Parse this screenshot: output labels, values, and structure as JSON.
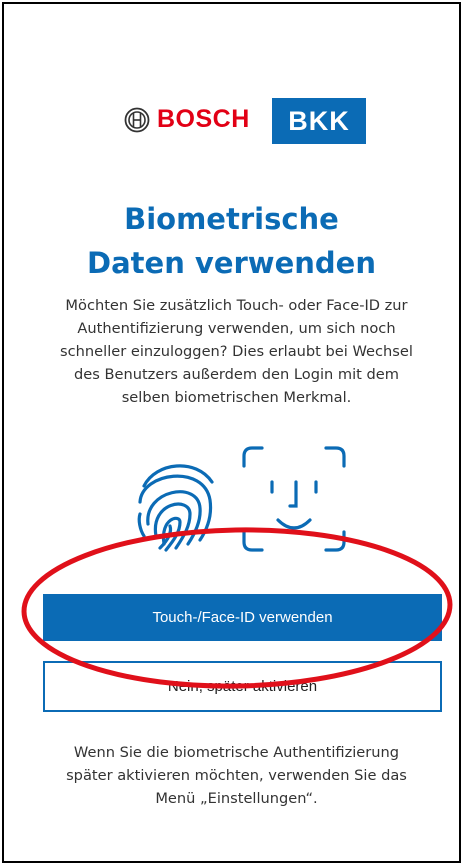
{
  "brand": {
    "bosch_text": "BOSCH",
    "bkk_text": "BKK",
    "bosch_color": "#e20015",
    "bkk_color": "#0b6bb5"
  },
  "title": {
    "line1": "Biometrische",
    "line2": "Daten verwenden"
  },
  "description": {
    "lines": [
      "Möchten Sie zusätzlich Touch- oder Face-ID zur",
      "Authentifizierung verwenden, um sich noch",
      "schneller einzuloggen? Dies erlaubt bei Wechsel",
      "des Benutzers außerdem den Login mit dem",
      "selben biometrischen Merkmal."
    ]
  },
  "icons": [
    "fingerprint-icon",
    "face-id-icon"
  ],
  "buttons": {
    "primary_label": "Touch-/Face-ID verwenden",
    "secondary_label": "Nein, später aktivieren"
  },
  "note": {
    "lines": [
      "Wenn Sie die biometrische Authentifizierung",
      "später aktivieren möchten, verwenden Sie das",
      "Menü „Einstellungen“."
    ]
  },
  "colors": {
    "accent": "#0b6bb5",
    "annotation": "#e0101a"
  }
}
